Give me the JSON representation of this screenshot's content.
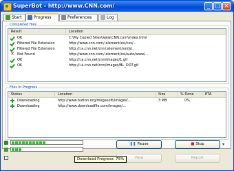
{
  "window": {
    "title": "SuperBot - http://www.CNN.com/"
  },
  "title_buttons": {
    "minimize": "_",
    "maximize": "□",
    "close": "×"
  },
  "tabs": [
    {
      "label": "Start",
      "icon": "start-icon"
    },
    {
      "label": "Progress",
      "icon": "progress-icon"
    },
    {
      "label": "Preferences",
      "icon": "preferences-icon"
    },
    {
      "label": "Log",
      "icon": "log-icon"
    }
  ],
  "completed": {
    "group_label": "Completed files",
    "columns": [
      "Result",
      "Location"
    ],
    "rows": [
      {
        "status": "ok",
        "result": "OK",
        "location": "C:\\My Copied Sites\\www.CNN.com\\index.html"
      },
      {
        "status": "ok",
        "result": "Filtered File Extension",
        "location": "http://www.cnn.com/.element/ssi/css/..."
      },
      {
        "status": "ok",
        "result": "Filtered File Extension",
        "location": "http://i.a.cnn.net/cnn/.element/ssi/js/..."
      },
      {
        "status": "bad",
        "result": "Not Found",
        "location": "http://www.cnn.com/.element/ssi/auto/www/..."
      },
      {
        "status": "ok",
        "result": "OK",
        "location": "http://i.a.cnn.net/cnn/images/1.gif"
      },
      {
        "status": "ok",
        "result": "OK",
        "location": "http://i.a.cnn.net/cnn/images/BL_DOT.gif"
      }
    ]
  },
  "in_progress": {
    "group_label": "Files In Progress",
    "columns": [
      "Status",
      "Location",
      "Size",
      "% Done",
      "ETA"
    ],
    "rows": [
      {
        "status": "Downloading",
        "location": "http://www.button.org/megasoft/images/...",
        "size": "3 MB",
        "done": "0%",
        "eta": ""
      },
      {
        "status": "Downloading",
        "location": "http://www.downloadfile.com/images/...",
        "size": "",
        "done": "",
        "eta": ""
      }
    ]
  },
  "progress": {
    "primary_filled": 10,
    "primary_total": 22,
    "secondary_filled": 3,
    "secondary_total": 22
  },
  "buttons": {
    "pause": "Pause",
    "stop": "Stop",
    "view": "View",
    "report": "Report"
  },
  "tooltip": "Download Progress: 75%",
  "colors": {
    "title_bar": "#0a5ae0",
    "progress": "#30c030",
    "group_label": "#0046d5"
  }
}
